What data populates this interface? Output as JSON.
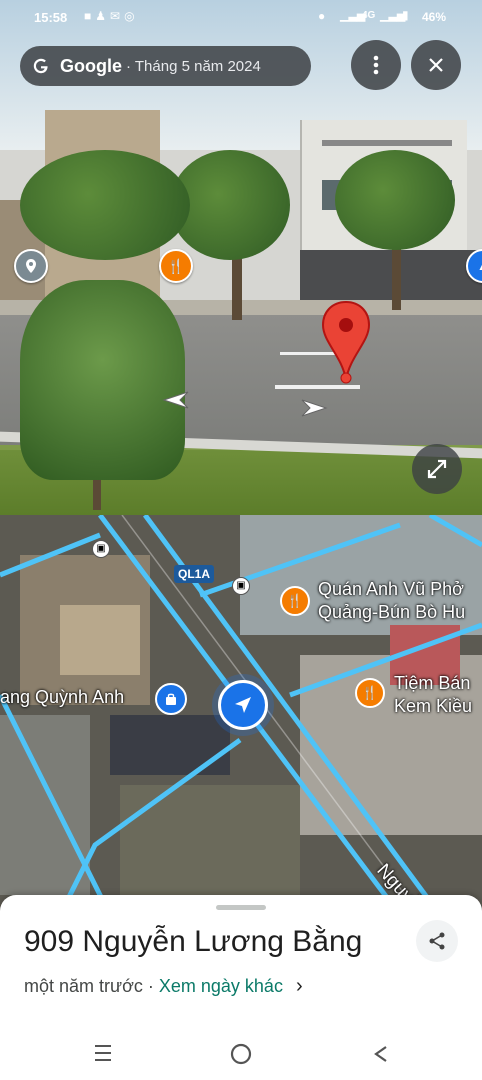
{
  "status_bar": {
    "time": "15:58",
    "left_icons": [
      "facebook-icon",
      "person-icon",
      "gmail-icon",
      "messenger-icon"
    ],
    "right_icons": [
      "location-icon",
      "signal-icon",
      "wifi-4g-icon",
      "battery-icon"
    ],
    "network": "4G",
    "battery": "46%"
  },
  "header": {
    "brand": "Google",
    "date": "· Tháng 5 năm 2024",
    "more_icon": "more-vert-icon",
    "close_icon": "close-icon"
  },
  "street_view": {
    "expand_icon": "fullscreen-icon",
    "pin_color": "#ea4335"
  },
  "map": {
    "route_label": "QL1A",
    "places": [
      {
        "name": "Quán Anh Vũ Phở\nQuảng-Bún Bò Hu",
        "icon": "restaurant-icon"
      },
      {
        "name": "Tiệm Bán\nKem Kiều",
        "icon": "restaurant-icon"
      },
      {
        "name": "ang Quỳnh Anh",
        "icon": "shopping-bag-icon"
      }
    ],
    "street_label": "Nguyễn Lư",
    "road_color": "#4fc3f7",
    "poi_color": "#f57c00"
  },
  "sheet": {
    "address": "909 Nguyễn Lương Bằng",
    "time_ago": "một năm trước",
    "separator": " · ",
    "other_dates": "Xem ngày khác",
    "chevron": "›"
  },
  "navbar": {
    "icons": [
      "recents-icon",
      "home-icon",
      "back-icon"
    ]
  }
}
